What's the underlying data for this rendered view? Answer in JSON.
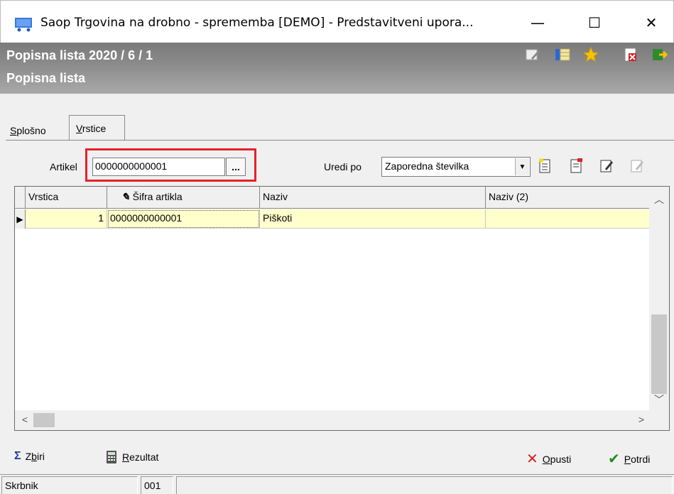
{
  "window": {
    "title": "Saop Trgovina na drobno - sprememba [DEMO] - Predstavitveni upora...",
    "minimize": "—",
    "maximize": "☐",
    "close": "✕"
  },
  "header": {
    "title": "Popisna lista 2020 / 6 / 1",
    "subtitle": "Popisna lista",
    "icons": [
      "edit-note-icon",
      "columns-icon",
      "star-icon",
      "close-doc-icon",
      "exit-icon"
    ]
  },
  "tabs": [
    {
      "label_pre": "",
      "label_u": "S",
      "label_post": "plošno"
    },
    {
      "label_pre": "",
      "label_u": "V",
      "label_post": "rstice"
    }
  ],
  "filter": {
    "artikel_label": "Artikel",
    "artikel_value": "0000000000001",
    "browse_label": "...",
    "uredi_label": "Uredi po",
    "uredi_value": "Zaporedna številka"
  },
  "grid": {
    "columns": [
      "Vrstica",
      "Šifra artikla",
      "Naziv",
      "Naziv (2)"
    ],
    "rows": [
      {
        "vrstica": "1",
        "sifra": "0000000000001",
        "naziv": "Piškoti",
        "naziv2": ""
      }
    ]
  },
  "buttons": {
    "zbiri_u": "b",
    "zbiri_pre": "Z",
    "zbiri_post": "iri",
    "rezultat_u": "R",
    "rezultat_post": "ezultat",
    "opusti_u": "O",
    "opusti_post": "pusti",
    "potrdi_u": "P",
    "potrdi_post": "otrdi"
  },
  "status": {
    "user": "Skrbnik",
    "code": "001"
  },
  "colors": {
    "highlight": "#e8202a",
    "row_selected": "#ffffcc"
  }
}
